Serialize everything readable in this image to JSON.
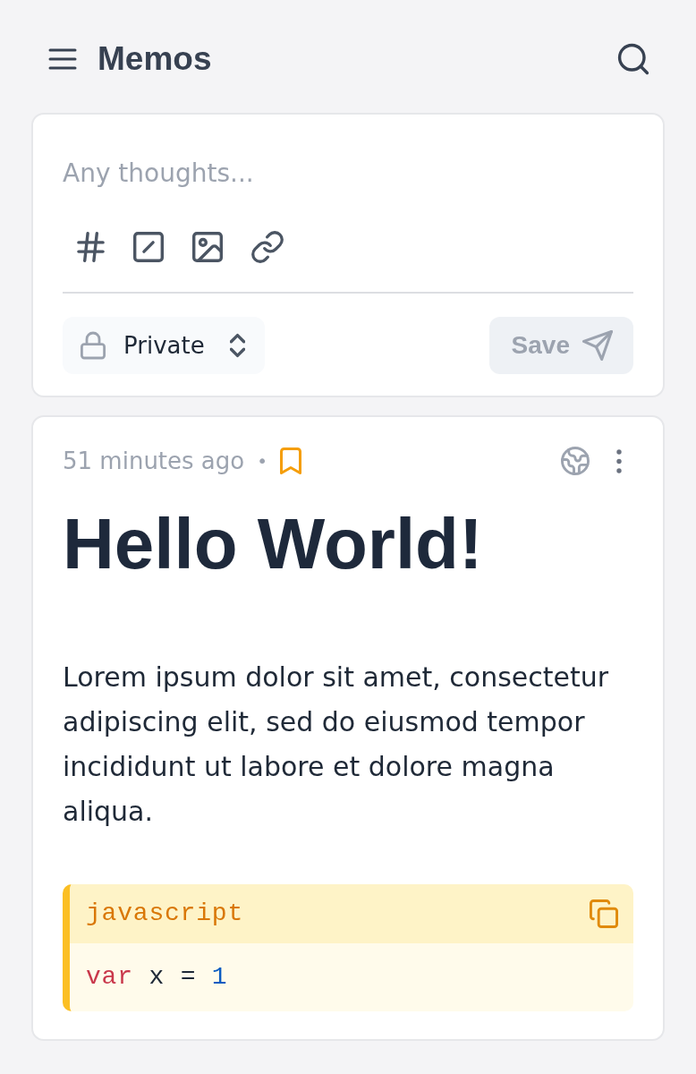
{
  "header": {
    "title": "Memos"
  },
  "editor": {
    "placeholder": "Any thoughts...",
    "visibility": {
      "value": "Private"
    },
    "save_button": {
      "label": "Save",
      "disabled": true
    }
  },
  "memo": {
    "time": "51 minutes ago",
    "separator": "•",
    "pinned": true,
    "heading": "Hello World!",
    "paragraph": "Lorem ipsum dolor sit amet, consectetur adipiscing elit, sed do eiusmod tempor incididunt ut labore et dolore magna aliqua.",
    "code_block": {
      "language": "javascript",
      "lines": [
        [
          {
            "text": "var",
            "kind": "keyword"
          },
          {
            "text": "x",
            "kind": "plain"
          },
          {
            "text": "=",
            "kind": "operator"
          },
          {
            "text": "1",
            "kind": "number"
          }
        ]
      ]
    }
  }
}
